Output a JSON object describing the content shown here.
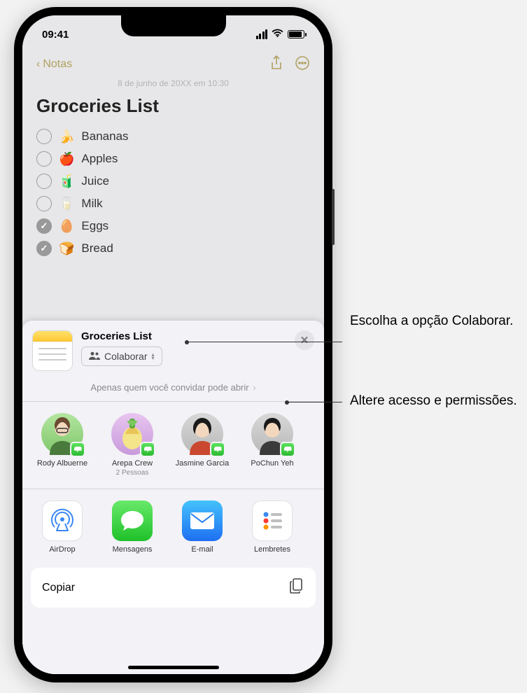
{
  "status": {
    "time": "09:41"
  },
  "nav": {
    "back": "Notas",
    "date": "8 de junho de 20XX em 10:30"
  },
  "note": {
    "title": "Groceries List",
    "items": [
      {
        "emoji": "🍌",
        "label": "Bananas",
        "checked": false
      },
      {
        "emoji": "🍎",
        "label": "Apples",
        "checked": false
      },
      {
        "emoji": "🧃",
        "label": "Juice",
        "checked": false
      },
      {
        "emoji": "🥛",
        "label": "Milk",
        "checked": false
      },
      {
        "emoji": "🥚",
        "label": "Eggs",
        "checked": true
      },
      {
        "emoji": "🍞",
        "label": "Bread",
        "checked": true
      }
    ]
  },
  "sheet": {
    "title": "Groceries List",
    "collab_label": "Colaborar",
    "permission": "Apenas quem você convidar pode abrir",
    "contacts": [
      {
        "name": "Rody Albuerne",
        "sub": ""
      },
      {
        "name": "Arepa Crew",
        "sub": "2 Pessoas"
      },
      {
        "name": "Jasmine Garcia",
        "sub": ""
      },
      {
        "name": "PoChun Yeh",
        "sub": ""
      }
    ],
    "apps": {
      "airdrop": "AirDrop",
      "messages": "Mensagens",
      "mail": "E-mail",
      "reminders": "Lembretes"
    },
    "copy": "Copiar"
  },
  "callouts": {
    "collab": "Escolha a opção Colaborar.",
    "perm": "Altere acesso e permissões."
  }
}
